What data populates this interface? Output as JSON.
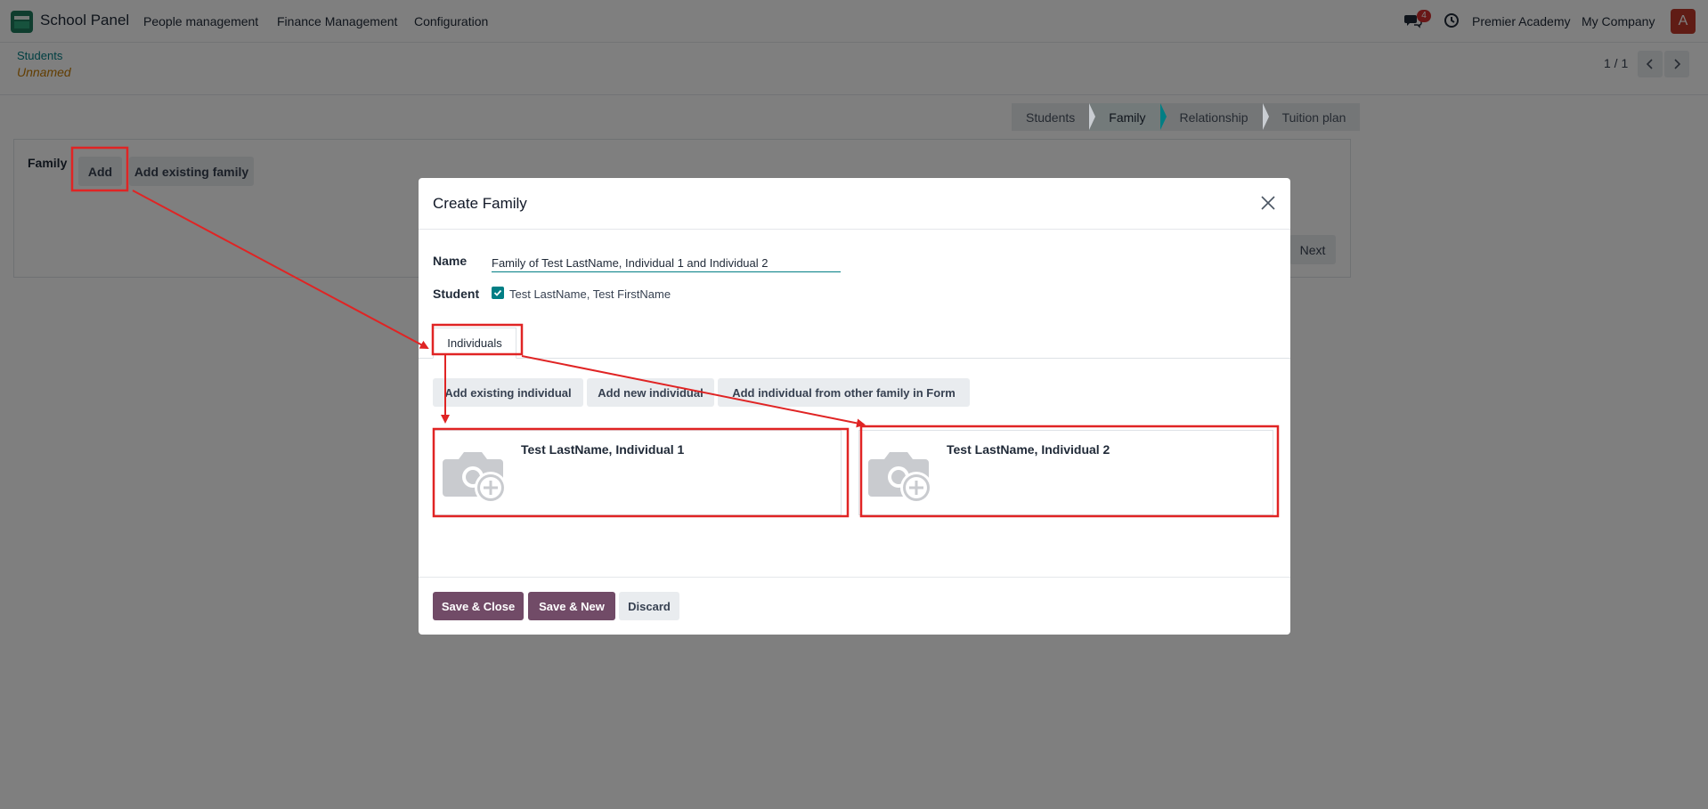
{
  "navbar": {
    "app_name": "School Panel",
    "menu": [
      "People management",
      "Finance Management",
      "Configuration"
    ],
    "chat_count": "4",
    "company_current": "Premier Academy",
    "company_main": "My Company",
    "user_initial": "A"
  },
  "breadcrumb": {
    "parent": "Students",
    "current": "Unnamed"
  },
  "pager": {
    "value": "1 / 1"
  },
  "statusbar": {
    "stages": [
      "Students",
      "Family",
      "Relationship",
      "Tuition plan"
    ],
    "active": "Family"
  },
  "family_section": {
    "label": "Family",
    "add_button": "Add",
    "add_existing_button": "Add existing family",
    "next_button": "Next"
  },
  "modal": {
    "title": "Create Family",
    "name_label": "Name",
    "name_value": "Family of Test LastName, Individual 1 and Individual 2",
    "student_label": "Student",
    "student_value": "Test LastName, Test FirstName",
    "tab_label": "Individuals",
    "actions": [
      "Add existing individual",
      "Add new individual",
      "Add individual from other family in Form"
    ],
    "individuals": [
      "Test LastName, Individual 1",
      "Test LastName, Individual 2"
    ],
    "footer": {
      "save_close": "Save & Close",
      "save_new": "Save & New",
      "discard": "Discard"
    }
  },
  "colors": {
    "annotation": "#e02424",
    "primary": "#714b67",
    "accent": "#017e84",
    "overlay": "rgba(0,0,0,0.5)"
  }
}
